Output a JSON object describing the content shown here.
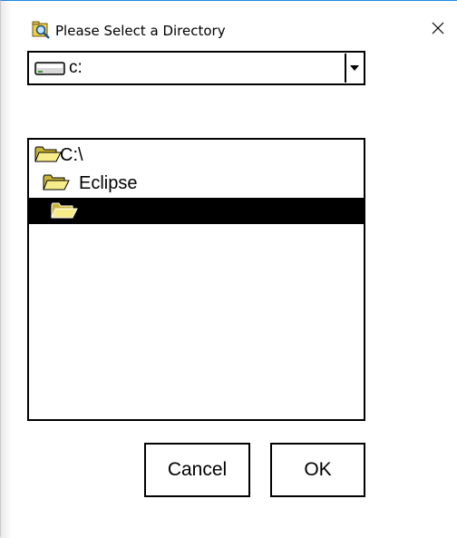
{
  "window": {
    "title": "Please Select a Directory",
    "title_icon": "folder-search-icon",
    "close_glyph": "✕",
    "accent_color": "#1e88e5"
  },
  "drive_combo": {
    "value": "c:",
    "icon": "drive-icon",
    "arrow_icon": "dropdown-arrow-icon"
  },
  "tree": {
    "items": [
      {
        "label": "C:\\",
        "icon": "open-folder-icon",
        "selected": false
      },
      {
        "label": "Eclipse",
        "icon": "open-folder-icon",
        "selected": false
      },
      {
        "label": "",
        "icon": "open-folder-icon",
        "selected": true
      }
    ],
    "selection_color": "#000000"
  },
  "buttons": {
    "cancel_label": "Cancel",
    "ok_label": "OK"
  }
}
